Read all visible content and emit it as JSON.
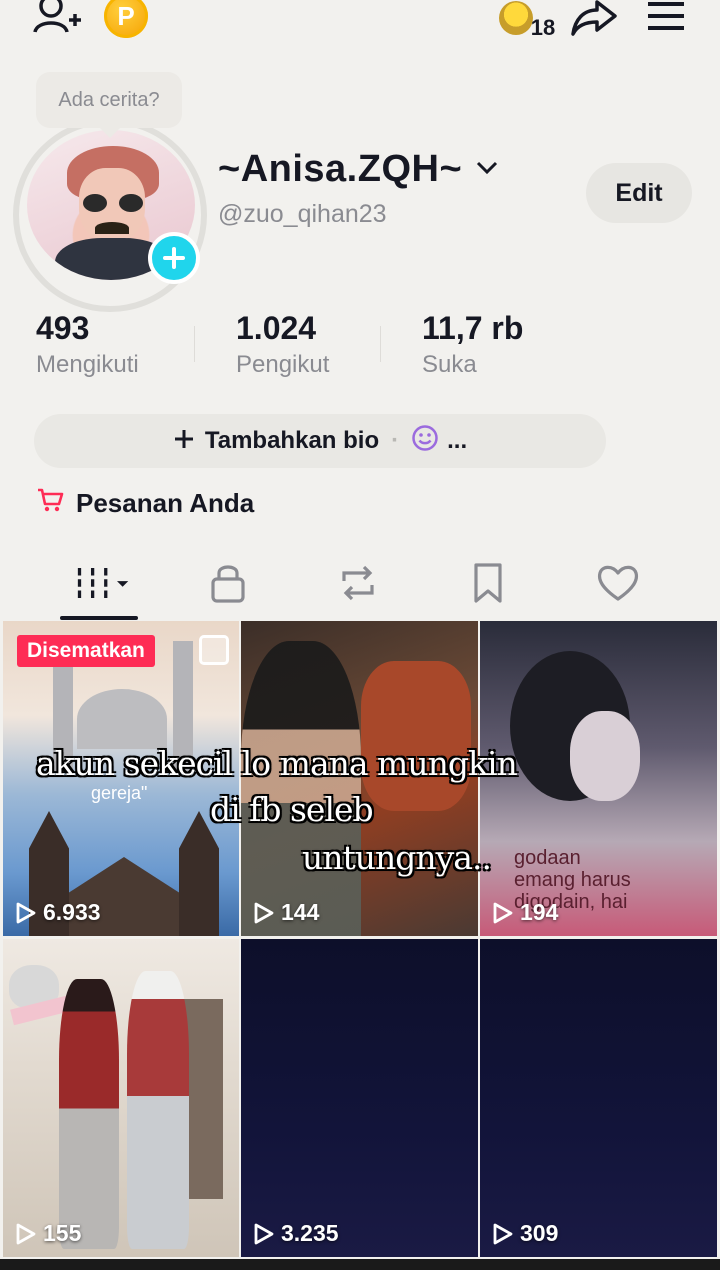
{
  "topbar": {
    "coin_letter": "P",
    "notification_count": "18"
  },
  "profile": {
    "story_prompt": "Ada cerita?",
    "display_name": "~Anisa.ZQH~",
    "username": "@zuo_qihan23",
    "edit_label": "Edit"
  },
  "stats": [
    {
      "value": "493",
      "label": "Mengikuti"
    },
    {
      "value": "1.024",
      "label": "Pengikut"
    },
    {
      "value": "11,7 rb",
      "label": "Suka"
    }
  ],
  "bio": {
    "add_label": "Tambahkan bio",
    "more": "..."
  },
  "orders_label": "Pesanan Anda",
  "videos": [
    {
      "views": "6.933",
      "pinned_label": "Disematkan",
      "caption": "gereja\""
    },
    {
      "views": "144"
    },
    {
      "views": "194",
      "caption": "godaan\nemang harus\ndigodain, hai"
    },
    {
      "views": "155"
    },
    {
      "views": "3.235"
    },
    {
      "views": "309"
    }
  ],
  "overlay": {
    "line1": "akun sekecil lo mana mungkin",
    "line2": "di fb seleb",
    "line3": "untungnya.."
  },
  "colors": {
    "accent": "#fe2c55",
    "avatar_add": "#20d5ec",
    "coin": "#f5a000"
  }
}
